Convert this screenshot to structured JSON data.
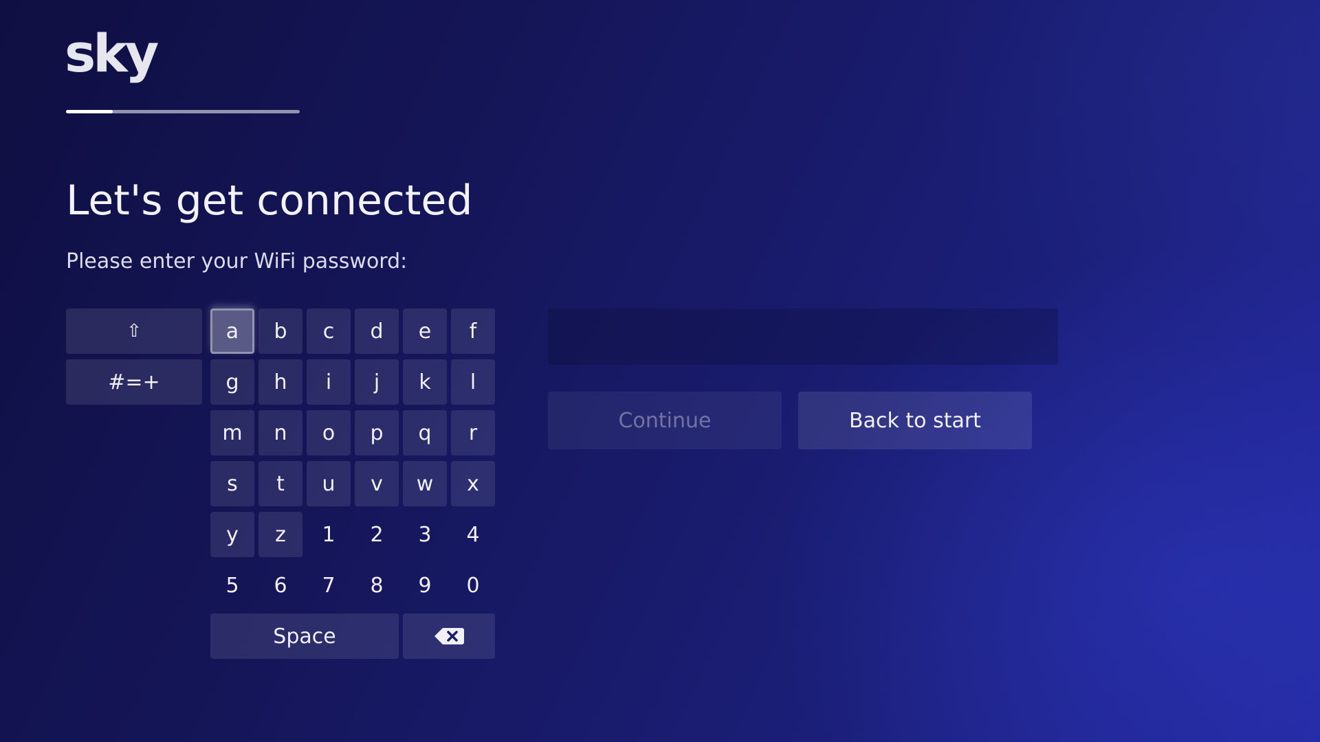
{
  "brand": {
    "logo_text": "sky"
  },
  "progress": {
    "fraction": 0.2
  },
  "heading": {
    "title": "Let's get connected",
    "subtitle": "Please enter your WiFi password:"
  },
  "keyboard": {
    "shift_icon": "shift-arrow-icon",
    "shift_glyph": "⇧",
    "symbols_label": "#=+",
    "focused_key": "a",
    "letters": [
      "a",
      "b",
      "c",
      "d",
      "e",
      "f",
      "g",
      "h",
      "i",
      "j",
      "k",
      "l",
      "m",
      "n",
      "o",
      "p",
      "q",
      "r",
      "s",
      "t",
      "u",
      "v",
      "w",
      "x",
      "y",
      "z"
    ],
    "digits": [
      "1",
      "2",
      "3",
      "4",
      "5",
      "6",
      "7",
      "8",
      "9",
      "0"
    ],
    "space_label": "Space",
    "backspace_icon": "backspace-icon"
  },
  "password_field": {
    "value": ""
  },
  "actions": {
    "continue_label": "Continue",
    "back_label": "Back to start"
  }
}
